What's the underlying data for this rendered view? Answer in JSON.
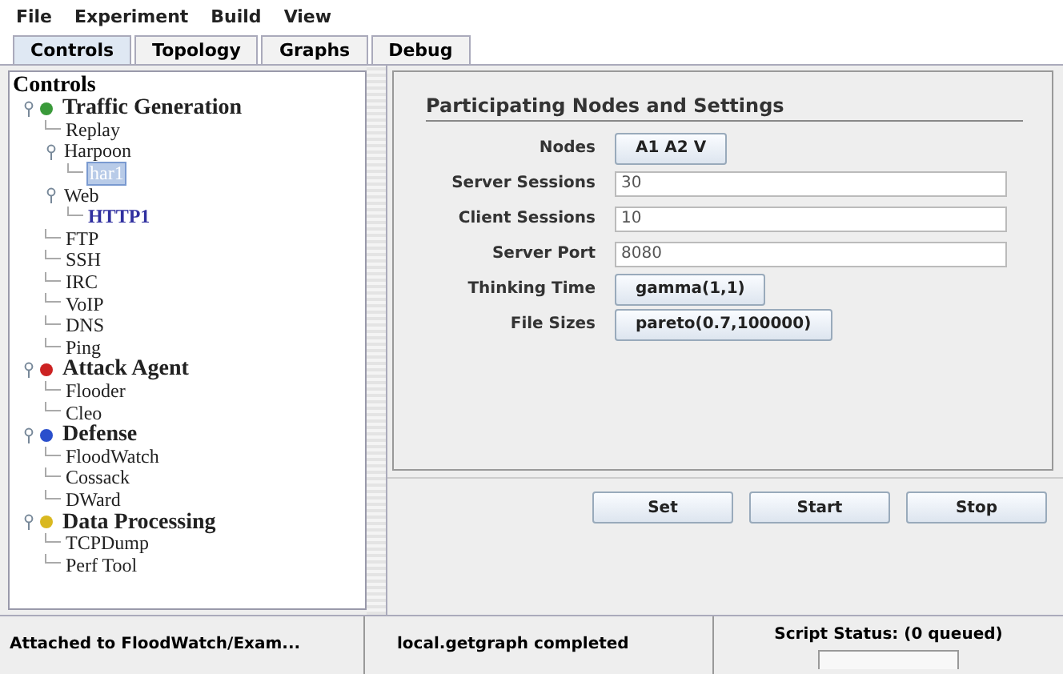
{
  "menu": [
    "File",
    "Experiment",
    "Build",
    "View"
  ],
  "tabs": [
    {
      "label": "Controls",
      "selected": true
    },
    {
      "label": "Topology",
      "selected": false
    },
    {
      "label": "Graphs",
      "selected": false
    },
    {
      "label": "Debug",
      "selected": false
    }
  ],
  "tree": {
    "title": "Controls",
    "items": [
      {
        "label": "Traffic Generation",
        "color": "#3a9a3a",
        "expanded": true,
        "selected": false,
        "children": [
          {
            "label": "Replay",
            "selected": false
          },
          {
            "label": "Harpoon",
            "expanded": true,
            "selected": false,
            "children": [
              {
                "label": "har1",
                "selected": true
              }
            ]
          },
          {
            "label": "Web",
            "expanded": true,
            "selected": false,
            "children": [
              {
                "label": "HTTP1",
                "selected": false,
                "kind": "link"
              }
            ]
          },
          {
            "label": "FTP",
            "selected": false
          },
          {
            "label": "SSH",
            "selected": false
          },
          {
            "label": "IRC",
            "selected": false
          },
          {
            "label": "VoIP",
            "selected": false
          },
          {
            "label": "DNS",
            "selected": false
          },
          {
            "label": "Ping",
            "selected": false
          }
        ]
      },
      {
        "label": "Attack Agent",
        "color": "#cc2222",
        "expanded": true,
        "selected": false,
        "children": [
          {
            "label": "Flooder",
            "selected": false
          },
          {
            "label": "Cleo",
            "selected": false
          }
        ]
      },
      {
        "label": "Defense",
        "color": "#2a4fcc",
        "expanded": true,
        "selected": false,
        "children": [
          {
            "label": "FloodWatch",
            "selected": false
          },
          {
            "label": "Cossack",
            "selected": false
          },
          {
            "label": "DWard",
            "selected": false
          }
        ]
      },
      {
        "label": "Data Processing",
        "color": "#d9b820",
        "expanded": true,
        "selected": false,
        "children": [
          {
            "label": "TCPDump",
            "selected": false
          },
          {
            "label": "Perf Tool",
            "selected": false
          }
        ]
      }
    ]
  },
  "settings": {
    "title": "Participating Nodes and Settings",
    "fields": [
      {
        "label": "Nodes",
        "kind": "button",
        "value": "A1 A2 V"
      },
      {
        "label": "Server Sessions",
        "kind": "text",
        "value": "30"
      },
      {
        "label": "Client Sessions",
        "kind": "text",
        "value": "10"
      },
      {
        "label": "Server Port",
        "kind": "text",
        "value": "8080"
      },
      {
        "label": "Thinking Time",
        "kind": "button",
        "value": "gamma(1,1)"
      },
      {
        "label": "File Sizes",
        "kind": "button",
        "value": "pareto(0.7,100000)"
      }
    ]
  },
  "actions": [
    "Set",
    "Start",
    "Stop"
  ],
  "status_bar": {
    "message": "Attached to FloodWatch/Exam...",
    "result": "local.getgraph completed",
    "script_status": "Script Status:  (0 queued)"
  }
}
